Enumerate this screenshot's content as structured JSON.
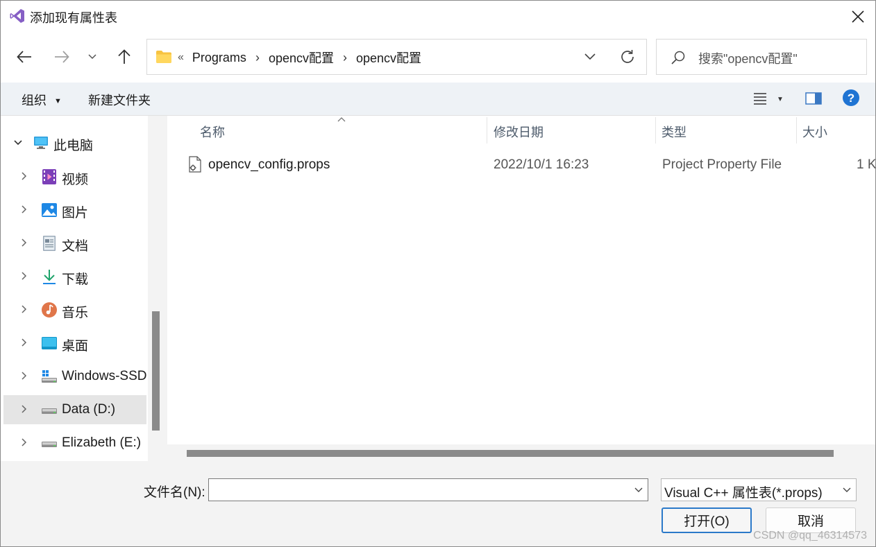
{
  "window": {
    "title": "添加现有属性表"
  },
  "address": {
    "overflow_marker": "«",
    "crumbs": [
      "Programs",
      "opencv配置",
      "opencv配置"
    ]
  },
  "search": {
    "placeholder": "搜索\"opencv配置\""
  },
  "toolbar": {
    "organize_label": "组织",
    "new_folder_label": "新建文件夹"
  },
  "nav_pane": {
    "items": [
      {
        "label": "此电脑",
        "icon": "computer-icon",
        "expanded": true
      },
      {
        "label": "视频",
        "icon": "video-icon"
      },
      {
        "label": "图片",
        "icon": "pictures-icon"
      },
      {
        "label": "文档",
        "icon": "documents-icon"
      },
      {
        "label": "下载",
        "icon": "download-icon"
      },
      {
        "label": "音乐",
        "icon": "music-icon"
      },
      {
        "label": "桌面",
        "icon": "desktop-icon"
      },
      {
        "label": "Windows-SSD",
        "icon": "system-drive-icon"
      },
      {
        "label": "Data (D:)",
        "icon": "drive-icon",
        "selected": true
      },
      {
        "label": "Elizabeth (E:)",
        "icon": "drive-icon"
      }
    ]
  },
  "file_list": {
    "columns": [
      "名称",
      "修改日期",
      "类型",
      "大小"
    ],
    "rows": [
      {
        "name": "opencv_config.props",
        "modified": "2022/10/1 16:23",
        "type": "Project Property File",
        "size": "1 K",
        "icon": "props-file-icon"
      }
    ]
  },
  "bottom": {
    "filename_label": "文件名(N):",
    "filename_value": "",
    "filter_value": "Visual C++ 属性表(*.props)",
    "open_label": "打开(O)",
    "cancel_label": "取消"
  },
  "watermark": "CSDN @qq_46314573",
  "colors": {
    "accent": "#2b79c9",
    "vs_purple": "#865fc5",
    "help_blue": "#1f74d3"
  }
}
